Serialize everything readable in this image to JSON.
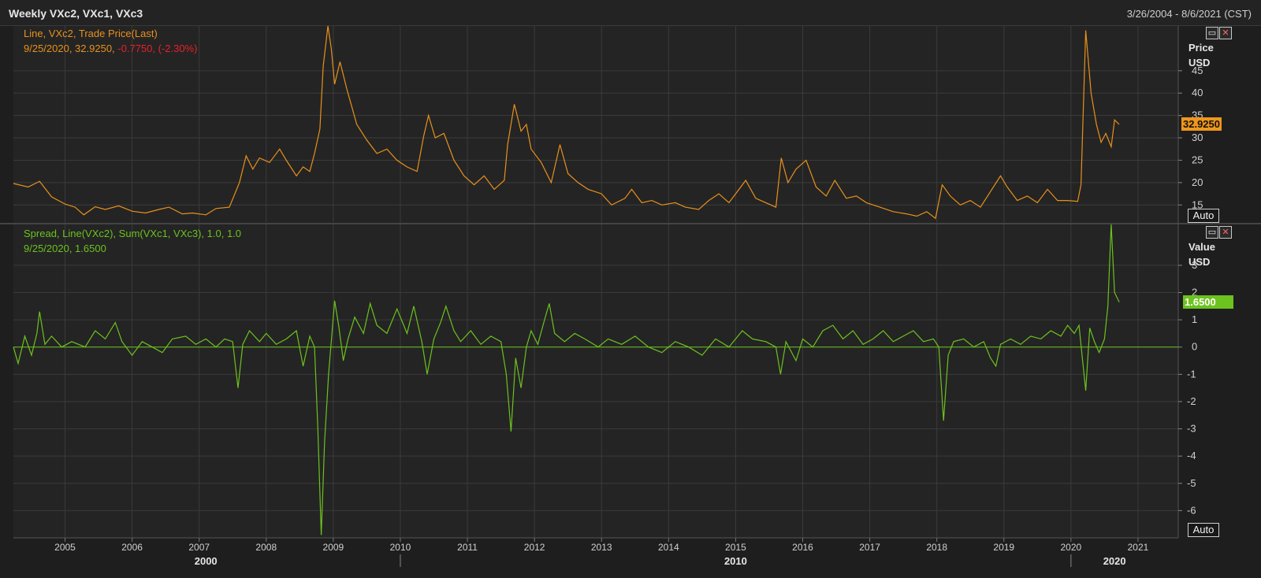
{
  "window": {
    "title": "Weekly VXc2, VXc1, VXc3",
    "date_range": "3/26/2004 - 8/6/2021 (CST)"
  },
  "colors": {
    "price_line": "#e8911c",
    "spread_line": "#6cc21e",
    "negative_text": "#e8202a",
    "grid": "#3b3b3b"
  },
  "icons": {
    "maximize": "maximize-icon",
    "close": "close-icon"
  },
  "top_panel": {
    "legend_line1": "Line, VXc2, Trade Price(Last)",
    "legend_line2_date_value": "9/25/2020, 32.9250,",
    "legend_line2_change": " -0.7750, (-2.30%)",
    "axis_title": "Price",
    "axis_unit": "USD",
    "last_value_label": "32.9250",
    "auto_label": "Auto"
  },
  "bottom_panel": {
    "legend_line1": "Spread, Line(VXc2), Sum(VXc1, VXc3),  1.0, 1.0",
    "legend_line2": "9/25/2020, 1.6500",
    "axis_title": "Value",
    "axis_unit": "USD",
    "last_value_label": "1.6500",
    "auto_label": "Auto"
  },
  "chart_data": [
    {
      "type": "line",
      "series": [
        {
          "name": "Line, VXc2, Trade Price(Last)"
        }
      ],
      "ylim": [
        11,
        55
      ],
      "y_ticks": [
        15,
        20,
        25,
        30,
        35,
        40,
        45
      ],
      "x_ticks": [
        "2005",
        "2006",
        "2007",
        "2008",
        "2009",
        "2010",
        "2011",
        "2012",
        "2013",
        "2014",
        "2015",
        "2016",
        "2017",
        "2018",
        "2019",
        "2020",
        "2021"
      ],
      "x_major_labels": [
        "2000",
        "2010",
        "2020"
      ],
      "last_value": 32.925,
      "grid": true,
      "points": [
        [
          2004.23,
          19.8
        ],
        [
          2004.45,
          19.0
        ],
        [
          2004.62,
          20.3
        ],
        [
          2004.8,
          16.8
        ],
        [
          2005.0,
          15.2
        ],
        [
          2005.15,
          14.5
        ],
        [
          2005.28,
          12.8
        ],
        [
          2005.45,
          14.6
        ],
        [
          2005.6,
          14.0
        ],
        [
          2005.8,
          14.8
        ],
        [
          2006.0,
          13.6
        ],
        [
          2006.2,
          13.2
        ],
        [
          2006.4,
          14.0
        ],
        [
          2006.55,
          14.5
        ],
        [
          2006.75,
          13.0
        ],
        [
          2006.9,
          13.2
        ],
        [
          2007.1,
          12.8
        ],
        [
          2007.25,
          14.2
        ],
        [
          2007.45,
          14.5
        ],
        [
          2007.6,
          20.0
        ],
        [
          2007.7,
          26.0
        ],
        [
          2007.8,
          23.0
        ],
        [
          2007.9,
          25.5
        ],
        [
          2008.05,
          24.5
        ],
        [
          2008.2,
          27.5
        ],
        [
          2008.3,
          25.0
        ],
        [
          2008.45,
          21.5
        ],
        [
          2008.55,
          23.5
        ],
        [
          2008.65,
          22.5
        ],
        [
          2008.72,
          26.5
        ],
        [
          2008.8,
          32.0
        ],
        [
          2008.85,
          46.0
        ],
        [
          2008.92,
          55.0
        ],
        [
          2008.97,
          50.0
        ],
        [
          2009.02,
          42.0
        ],
        [
          2009.1,
          47.0
        ],
        [
          2009.2,
          41.0
        ],
        [
          2009.35,
          33.0
        ],
        [
          2009.5,
          29.5
        ],
        [
          2009.65,
          26.5
        ],
        [
          2009.8,
          27.5
        ],
        [
          2009.95,
          25.0
        ],
        [
          2010.1,
          23.5
        ],
        [
          2010.25,
          22.5
        ],
        [
          2010.35,
          30.5
        ],
        [
          2010.42,
          35.0
        ],
        [
          2010.52,
          30.0
        ],
        [
          2010.65,
          31.0
        ],
        [
          2010.8,
          25.0
        ],
        [
          2010.95,
          21.5
        ],
        [
          2011.1,
          19.5
        ],
        [
          2011.25,
          21.5
        ],
        [
          2011.4,
          18.5
        ],
        [
          2011.55,
          20.5
        ],
        [
          2011.6,
          28.5
        ],
        [
          2011.7,
          37.5
        ],
        [
          2011.8,
          31.5
        ],
        [
          2011.88,
          33.0
        ],
        [
          2011.95,
          27.5
        ],
        [
          2012.1,
          24.5
        ],
        [
          2012.25,
          20.0
        ],
        [
          2012.38,
          28.5
        ],
        [
          2012.5,
          22.0
        ],
        [
          2012.65,
          20.0
        ],
        [
          2012.8,
          18.5
        ],
        [
          2013.0,
          17.5
        ],
        [
          2013.15,
          15.0
        ],
        [
          2013.35,
          16.5
        ],
        [
          2013.45,
          18.5
        ],
        [
          2013.6,
          15.5
        ],
        [
          2013.75,
          16.0
        ],
        [
          2013.9,
          15.0
        ],
        [
          2014.1,
          15.5
        ],
        [
          2014.25,
          14.5
        ],
        [
          2014.45,
          14.0
        ],
        [
          2014.6,
          16.0
        ],
        [
          2014.75,
          17.5
        ],
        [
          2014.9,
          15.5
        ],
        [
          2015.0,
          17.5
        ],
        [
          2015.15,
          20.5
        ],
        [
          2015.3,
          16.5
        ],
        [
          2015.45,
          15.5
        ],
        [
          2015.6,
          14.5
        ],
        [
          2015.68,
          25.5
        ],
        [
          2015.78,
          20.0
        ],
        [
          2015.9,
          23.0
        ],
        [
          2016.05,
          25.0
        ],
        [
          2016.2,
          19.0
        ],
        [
          2016.35,
          17.0
        ],
        [
          2016.48,
          20.5
        ],
        [
          2016.65,
          16.5
        ],
        [
          2016.8,
          17.0
        ],
        [
          2016.95,
          15.5
        ],
        [
          2017.15,
          14.5
        ],
        [
          2017.35,
          13.5
        ],
        [
          2017.55,
          13.0
        ],
        [
          2017.7,
          12.5
        ],
        [
          2017.85,
          13.5
        ],
        [
          2017.98,
          12.0
        ],
        [
          2018.08,
          19.5
        ],
        [
          2018.2,
          17.0
        ],
        [
          2018.35,
          15.0
        ],
        [
          2018.5,
          16.0
        ],
        [
          2018.65,
          14.5
        ],
        [
          2018.8,
          18.0
        ],
        [
          2018.95,
          21.5
        ],
        [
          2019.05,
          19.0
        ],
        [
          2019.2,
          16.0
        ],
        [
          2019.35,
          17.0
        ],
        [
          2019.5,
          15.5
        ],
        [
          2019.65,
          18.5
        ],
        [
          2019.8,
          16.0
        ],
        [
          2019.95,
          16.0
        ],
        [
          2020.1,
          15.8
        ],
        [
          2020.15,
          19.5
        ],
        [
          2020.22,
          54.0
        ],
        [
          2020.3,
          40.0
        ],
        [
          2020.38,
          33.0
        ],
        [
          2020.45,
          29.0
        ],
        [
          2020.52,
          31.0
        ],
        [
          2020.6,
          28.0
        ],
        [
          2020.65,
          34.0
        ],
        [
          2020.72,
          33.0
        ]
      ]
    },
    {
      "type": "line",
      "series": [
        {
          "name": "Spread, Line(VXc2), Sum(VXc1, VXc3),  1.0, 1.0"
        }
      ],
      "ylim": [
        -7,
        4.5
      ],
      "y_ticks": [
        -6,
        -5,
        -4,
        -3,
        -2,
        -1,
        0,
        1,
        2,
        3
      ],
      "x_ticks": [
        "2005",
        "2006",
        "2007",
        "2008",
        "2009",
        "2010",
        "2011",
        "2012",
        "2013",
        "2014",
        "2015",
        "2016",
        "2017",
        "2018",
        "2019",
        "2020",
        "2021"
      ],
      "last_value": 1.65,
      "grid": true,
      "points": [
        [
          2004.23,
          0.0
        ],
        [
          2004.3,
          -0.6
        ],
        [
          2004.4,
          0.4
        ],
        [
          2004.5,
          -0.3
        ],
        [
          2004.58,
          0.5
        ],
        [
          2004.62,
          1.3
        ],
        [
          2004.7,
          0.1
        ],
        [
          2004.8,
          0.4
        ],
        [
          2004.95,
          0.0
        ],
        [
          2005.1,
          0.2
        ],
        [
          2005.3,
          0.0
        ],
        [
          2005.45,
          0.6
        ],
        [
          2005.6,
          0.3
        ],
        [
          2005.75,
          0.9
        ],
        [
          2005.85,
          0.2
        ],
        [
          2006.0,
          -0.3
        ],
        [
          2006.15,
          0.2
        ],
        [
          2006.3,
          0.0
        ],
        [
          2006.45,
          -0.2
        ],
        [
          2006.6,
          0.3
        ],
        [
          2006.8,
          0.4
        ],
        [
          2006.95,
          0.1
        ],
        [
          2007.1,
          0.3
        ],
        [
          2007.25,
          0.0
        ],
        [
          2007.38,
          0.3
        ],
        [
          2007.5,
          0.2
        ],
        [
          2007.58,
          -1.5
        ],
        [
          2007.65,
          0.1
        ],
        [
          2007.75,
          0.6
        ],
        [
          2007.9,
          0.2
        ],
        [
          2008.0,
          0.5
        ],
        [
          2008.15,
          0.1
        ],
        [
          2008.3,
          0.3
        ],
        [
          2008.45,
          0.6
        ],
        [
          2008.55,
          -0.7
        ],
        [
          2008.65,
          0.4
        ],
        [
          2008.72,
          0.0
        ],
        [
          2008.77,
          -3.0
        ],
        [
          2008.82,
          -6.9
        ],
        [
          2008.87,
          -3.5
        ],
        [
          2008.93,
          -1.0
        ],
        [
          2008.98,
          0.5
        ],
        [
          2009.02,
          1.7
        ],
        [
          2009.08,
          0.8
        ],
        [
          2009.15,
          -0.5
        ],
        [
          2009.22,
          0.3
        ],
        [
          2009.32,
          1.1
        ],
        [
          2009.45,
          0.5
        ],
        [
          2009.55,
          1.6
        ],
        [
          2009.65,
          0.8
        ],
        [
          2009.8,
          0.5
        ],
        [
          2009.95,
          1.4
        ],
        [
          2010.1,
          0.5
        ],
        [
          2010.2,
          1.5
        ],
        [
          2010.32,
          0.2
        ],
        [
          2010.4,
          -1.0
        ],
        [
          2010.5,
          0.3
        ],
        [
          2010.6,
          0.9
        ],
        [
          2010.68,
          1.5
        ],
        [
          2010.8,
          0.6
        ],
        [
          2010.9,
          0.2
        ],
        [
          2011.05,
          0.6
        ],
        [
          2011.2,
          0.1
        ],
        [
          2011.35,
          0.4
        ],
        [
          2011.5,
          0.2
        ],
        [
          2011.58,
          -1.0
        ],
        [
          2011.65,
          -3.1
        ],
        [
          2011.72,
          -0.4
        ],
        [
          2011.8,
          -1.5
        ],
        [
          2011.88,
          0.0
        ],
        [
          2011.95,
          0.6
        ],
        [
          2012.05,
          0.1
        ],
        [
          2012.15,
          1.0
        ],
        [
          2012.22,
          1.6
        ],
        [
          2012.3,
          0.5
        ],
        [
          2012.45,
          0.2
        ],
        [
          2012.6,
          0.5
        ],
        [
          2012.75,
          0.3
        ],
        [
          2012.95,
          0.0
        ],
        [
          2013.1,
          0.3
        ],
        [
          2013.3,
          0.1
        ],
        [
          2013.5,
          0.4
        ],
        [
          2013.7,
          0.0
        ],
        [
          2013.9,
          -0.2
        ],
        [
          2014.1,
          0.2
        ],
        [
          2014.3,
          0.0
        ],
        [
          2014.5,
          -0.3
        ],
        [
          2014.7,
          0.3
        ],
        [
          2014.9,
          0.0
        ],
        [
          2015.1,
          0.6
        ],
        [
          2015.25,
          0.3
        ],
        [
          2015.45,
          0.2
        ],
        [
          2015.6,
          0.0
        ],
        [
          2015.67,
          -1.0
        ],
        [
          2015.75,
          0.2
        ],
        [
          2015.9,
          -0.5
        ],
        [
          2016.0,
          0.3
        ],
        [
          2016.15,
          0.0
        ],
        [
          2016.3,
          0.6
        ],
        [
          2016.45,
          0.8
        ],
        [
          2016.6,
          0.3
        ],
        [
          2016.75,
          0.6
        ],
        [
          2016.9,
          0.1
        ],
        [
          2017.05,
          0.3
        ],
        [
          2017.2,
          0.6
        ],
        [
          2017.35,
          0.2
        ],
        [
          2017.5,
          0.4
        ],
        [
          2017.65,
          0.6
        ],
        [
          2017.8,
          0.2
        ],
        [
          2017.95,
          0.3
        ],
        [
          2018.03,
          0.0
        ],
        [
          2018.1,
          -2.7
        ],
        [
          2018.17,
          -0.3
        ],
        [
          2018.25,
          0.2
        ],
        [
          2018.4,
          0.3
        ],
        [
          2018.55,
          0.0
        ],
        [
          2018.7,
          0.2
        ],
        [
          2018.8,
          -0.4
        ],
        [
          2018.88,
          -0.7
        ],
        [
          2018.95,
          0.1
        ],
        [
          2019.1,
          0.3
        ],
        [
          2019.25,
          0.1
        ],
        [
          2019.4,
          0.4
        ],
        [
          2019.55,
          0.3
        ],
        [
          2019.7,
          0.6
        ],
        [
          2019.85,
          0.4
        ],
        [
          2019.95,
          0.8
        ],
        [
          2020.05,
          0.5
        ],
        [
          2020.12,
          0.8
        ],
        [
          2020.17,
          -0.4
        ],
        [
          2020.22,
          -1.6
        ],
        [
          2020.28,
          0.7
        ],
        [
          2020.35,
          0.2
        ],
        [
          2020.42,
          -0.2
        ],
        [
          2020.5,
          0.3
        ],
        [
          2020.55,
          1.5
        ],
        [
          2020.6,
          4.5
        ],
        [
          2020.65,
          2.0
        ],
        [
          2020.72,
          1.65
        ]
      ]
    }
  ]
}
